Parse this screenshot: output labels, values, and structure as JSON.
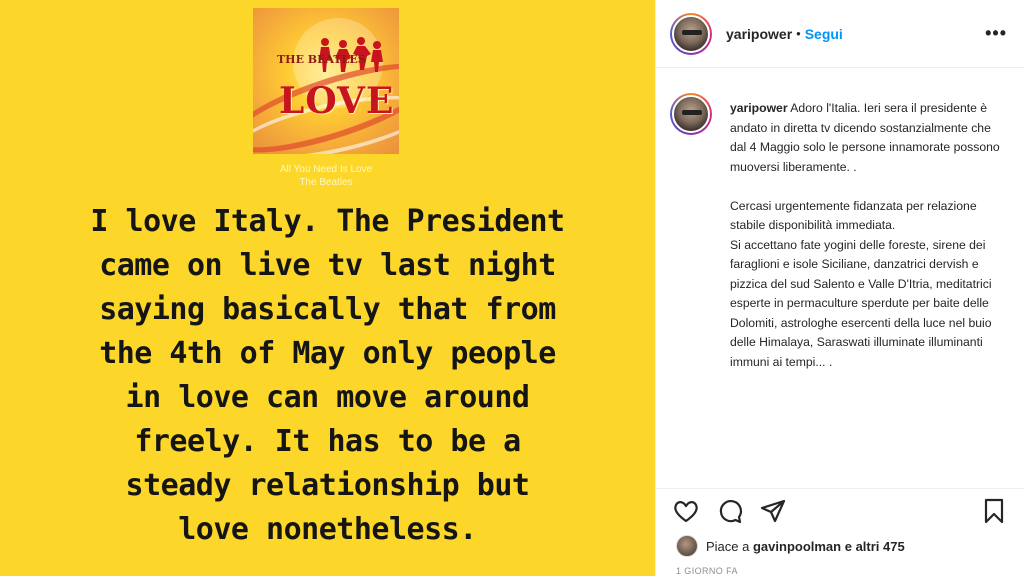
{
  "post": {
    "album": {
      "band": "THE BEATLES",
      "title": "LOVE"
    },
    "song": {
      "title": "All You Need Is Love",
      "artist": "The Beatles"
    },
    "story_text": "I love Italy. The President\ncame on live tv last night\nsaying basically that from\nthe 4th of May only people\nin love can move around\nfreely. It has to be a\nsteady relationship but\nlove nonetheless.",
    "background_color": "#fcd72a"
  },
  "header": {
    "username": "yaripower",
    "separator": "•",
    "follow_label": "Segui",
    "more_label": "•••"
  },
  "caption": {
    "username": "yaripower",
    "text": "Adoro l'Italia. Ieri sera il presidente è andato in diretta tv dicendo sostanzialmente che dal 4 Maggio solo le persone innamorate possono muoversi liberamente. .\n\nCercasi urgentemente fidanzata per relazione stabile disponibilità immediata.\nSi accettano fate yogini delle foreste, sirene dei faraglioni e isole Siciliane, danzatrici dervish e pizzica del sud Salento e Valle D'Itria, meditatrici esperte in permaculture sperdute per baite delle Dolomiti, astrologhe esercenti della luce nel buio delle Himalaya, Saraswati illuminate illuminanti immuni ai tempi... ."
  },
  "actions": {
    "icons": [
      "heart-icon",
      "comment-icon",
      "share-icon",
      "bookmark-icon"
    ]
  },
  "likes": {
    "prefix": "Piace a ",
    "user": "gavinpoolman",
    "suffix": " e altri 475"
  },
  "timestamp": "1 GIORNO FA",
  "colors": {
    "accent": "#0095f6",
    "text": "#262626",
    "muted": "#8e8e8e"
  }
}
